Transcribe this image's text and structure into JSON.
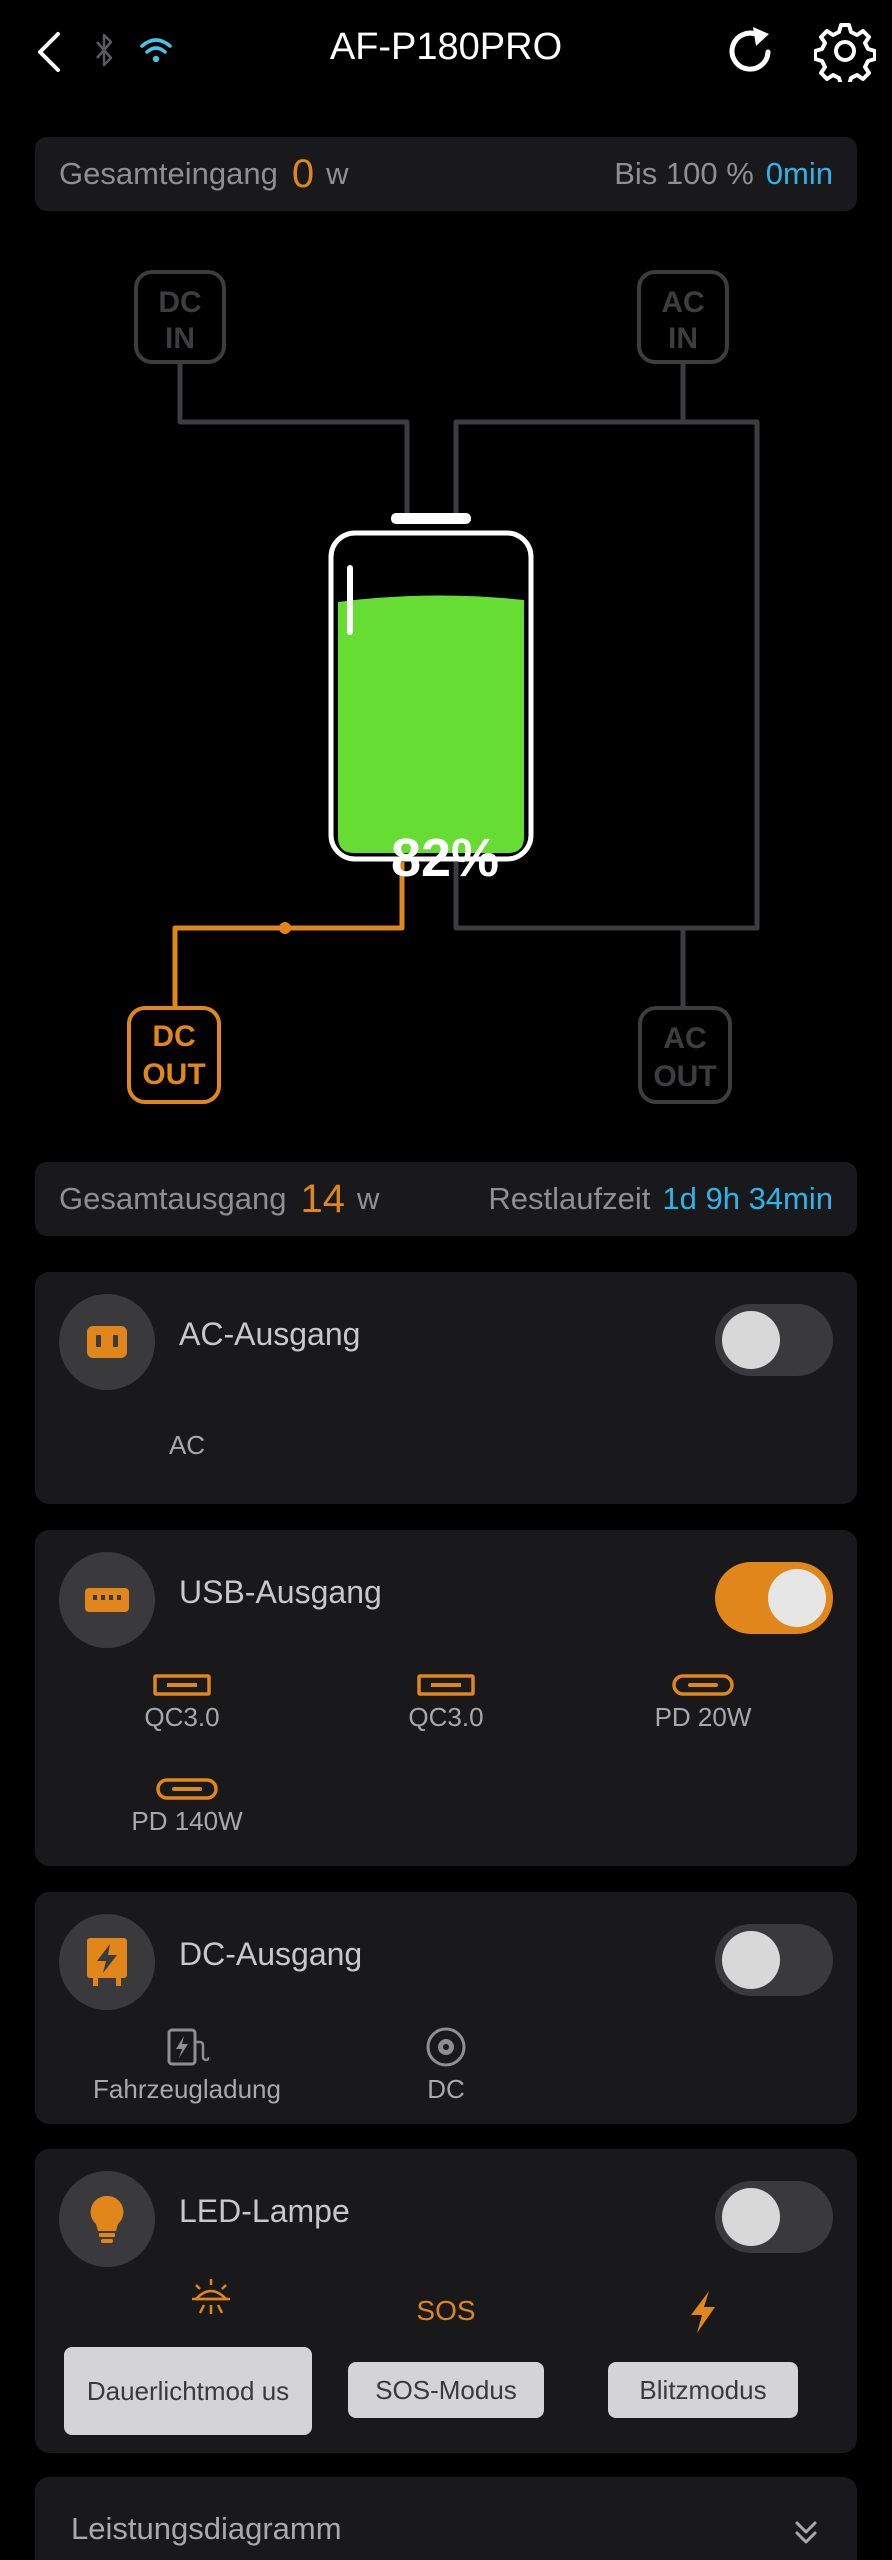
{
  "header": {
    "title": "AF-P180PRO"
  },
  "input_bar": {
    "label": "Gesamteingang",
    "value": "0",
    "unit": "w",
    "right_label": "Bis 100 %",
    "right_value": "0min"
  },
  "diagram": {
    "dc_in": [
      "DC",
      "IN"
    ],
    "ac_in": [
      "AC",
      "IN"
    ],
    "dc_out": [
      "DC",
      "OUT"
    ],
    "ac_out": [
      "AC",
      "OUT"
    ],
    "battery_percent": "82%",
    "battery_level": 0.82,
    "colors": {
      "active": "#e0861a",
      "inactive": "#3d3d40",
      "battery": "#66dd33"
    }
  },
  "output_bar": {
    "label": "Gesamtausgang",
    "value": "14",
    "unit": "w",
    "right_label": "Restlaufzeit",
    "right_value": "1d 9h 34min"
  },
  "ac_card": {
    "title": "AC-Ausgang",
    "icon": "ac-socket-icon",
    "enabled": false,
    "ports": [
      "AC"
    ]
  },
  "usb_card": {
    "title": "USB-Ausgang",
    "icon": "usb-icon",
    "enabled": true,
    "ports": [
      "QC3.0",
      "QC3.0",
      "PD 20W",
      "PD 140W"
    ]
  },
  "dc_card": {
    "title": "DC-Ausgang",
    "icon": "dc-bolt-icon",
    "enabled": false,
    "ports": [
      "Fahrzeugladung",
      "DC"
    ]
  },
  "led_card": {
    "title": "LED-Lampe",
    "icon": "lightbulb-icon",
    "enabled": false,
    "sos_icon_text": "SOS",
    "modes": [
      "Dauerlichtmod us",
      "SOS-Modus",
      "Blitzmodus"
    ]
  },
  "chart_section": {
    "title": "Leistungsdiagramm"
  }
}
